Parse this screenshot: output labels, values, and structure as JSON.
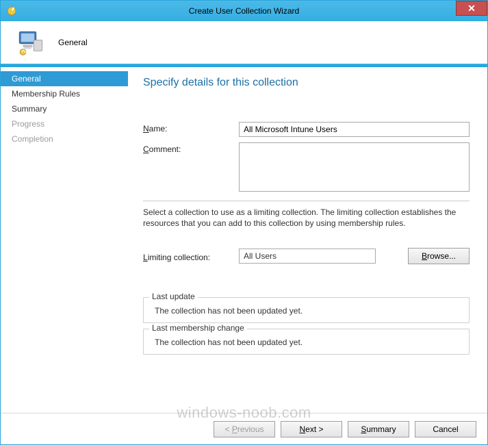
{
  "window": {
    "title": "Create User Collection Wizard"
  },
  "header": {
    "page_label": "General"
  },
  "sidebar": {
    "items": [
      {
        "label": "General",
        "state": "selected"
      },
      {
        "label": "Membership Rules",
        "state": "enabled"
      },
      {
        "label": "Summary",
        "state": "enabled"
      },
      {
        "label": "Progress",
        "state": "disabled"
      },
      {
        "label": "Completion",
        "state": "disabled"
      }
    ]
  },
  "page": {
    "title": "Specify details for this collection",
    "name_label": "Name:",
    "name_hotkey": "N",
    "name_value": "All Microsoft Intune Users",
    "comment_label": "Comment:",
    "comment_hotkey": "C",
    "comment_value": "",
    "help_text": "Select a collection to use as a limiting collection. The limiting collection establishes the resources that you can add to this collection by using membership rules.",
    "limiting_label": "Limiting collection:",
    "limiting_hotkey": "L",
    "limiting_value": "All Users",
    "browse_label": "Browse...",
    "browse_hotkey": "B",
    "last_update": {
      "legend": "Last update",
      "text": "The collection has not been updated yet."
    },
    "last_membership": {
      "legend": "Last membership change",
      "text": "The collection has not been updated yet."
    }
  },
  "footer": {
    "previous": "< Previous",
    "previous_hotkey": "P",
    "next": "Next >",
    "next_hotkey": "N",
    "summary": "Summary",
    "summary_hotkey": "S",
    "cancel": "Cancel"
  },
  "watermark": "windows-noob.com"
}
